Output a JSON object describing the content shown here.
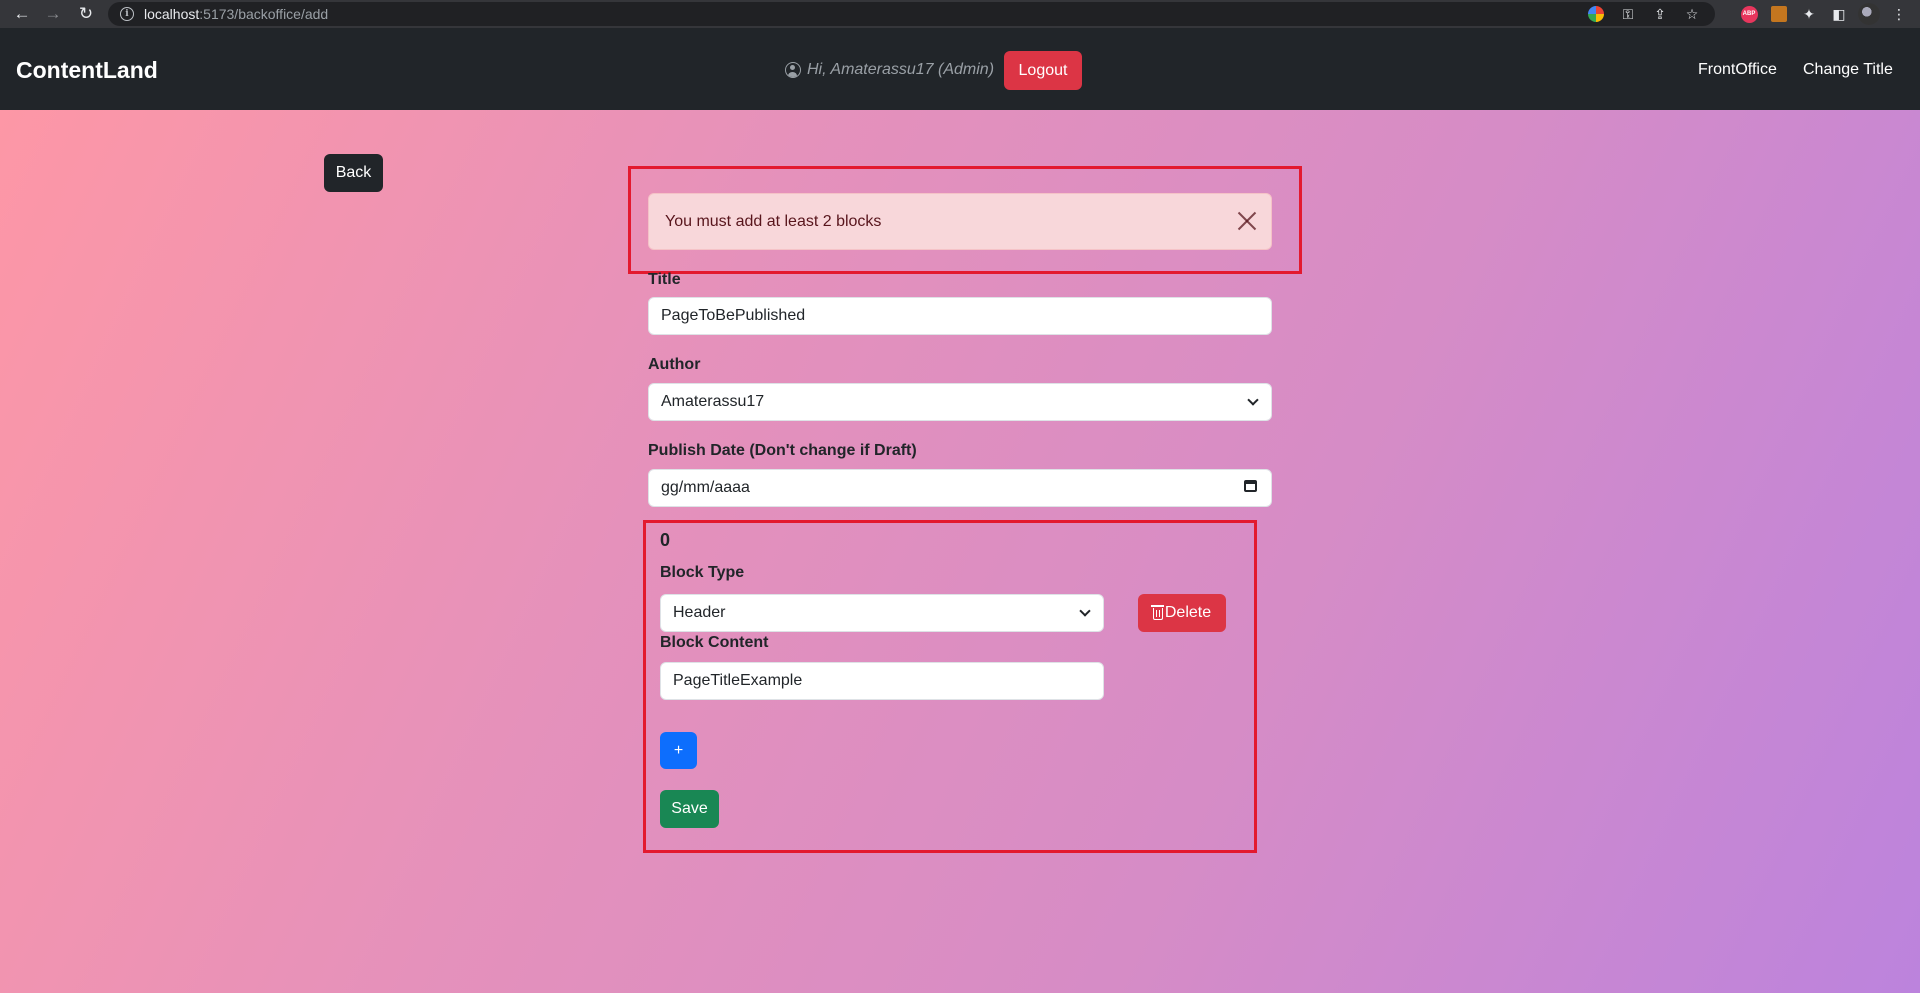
{
  "browser": {
    "url_host": "localhost",
    "url_path": ":5173/backoffice/add",
    "icons": [
      "back-arrow-icon",
      "forward-arrow-icon",
      "reload-icon",
      "info-icon",
      "google-icon",
      "key-icon",
      "share-icon",
      "star-icon",
      "adblock-icon",
      "extension-icon",
      "puzzle-icon",
      "sidepanel-icon",
      "profile-avatar",
      "kebab-menu-icon"
    ]
  },
  "navbar": {
    "brand": "ContentLand",
    "greeting": "Hi, Amaterassu17 (Admin)",
    "logout_label": "Logout",
    "links": [
      "FrontOffice",
      "Change Title"
    ]
  },
  "page": {
    "back_label": "Back",
    "alert_text": "You must add at least 2 blocks",
    "title_label": "Title",
    "title_value": "PageToBePublished",
    "author_label": "Author",
    "author_value": "Amaterassu17",
    "date_label": "Publish Date (Don't change if Draft)",
    "date_placeholder": "gg/mm/aaaa",
    "block": {
      "index": "0",
      "type_label": "Block Type",
      "type_value": "Header",
      "content_label": "Block Content",
      "content_value": "PageTitleExample",
      "delete_label": "Delete"
    },
    "add_label": "+",
    "save_label": "Save"
  },
  "colors": {
    "navbar_bg": "#212529",
    "danger": "#dc3545",
    "primary": "#0d6efd",
    "success": "#198754",
    "highlight": "#e3192f",
    "alert_bg": "#f8d7da",
    "gradient_start": "#fd97a6",
    "gradient_end": "#bc83dd"
  }
}
